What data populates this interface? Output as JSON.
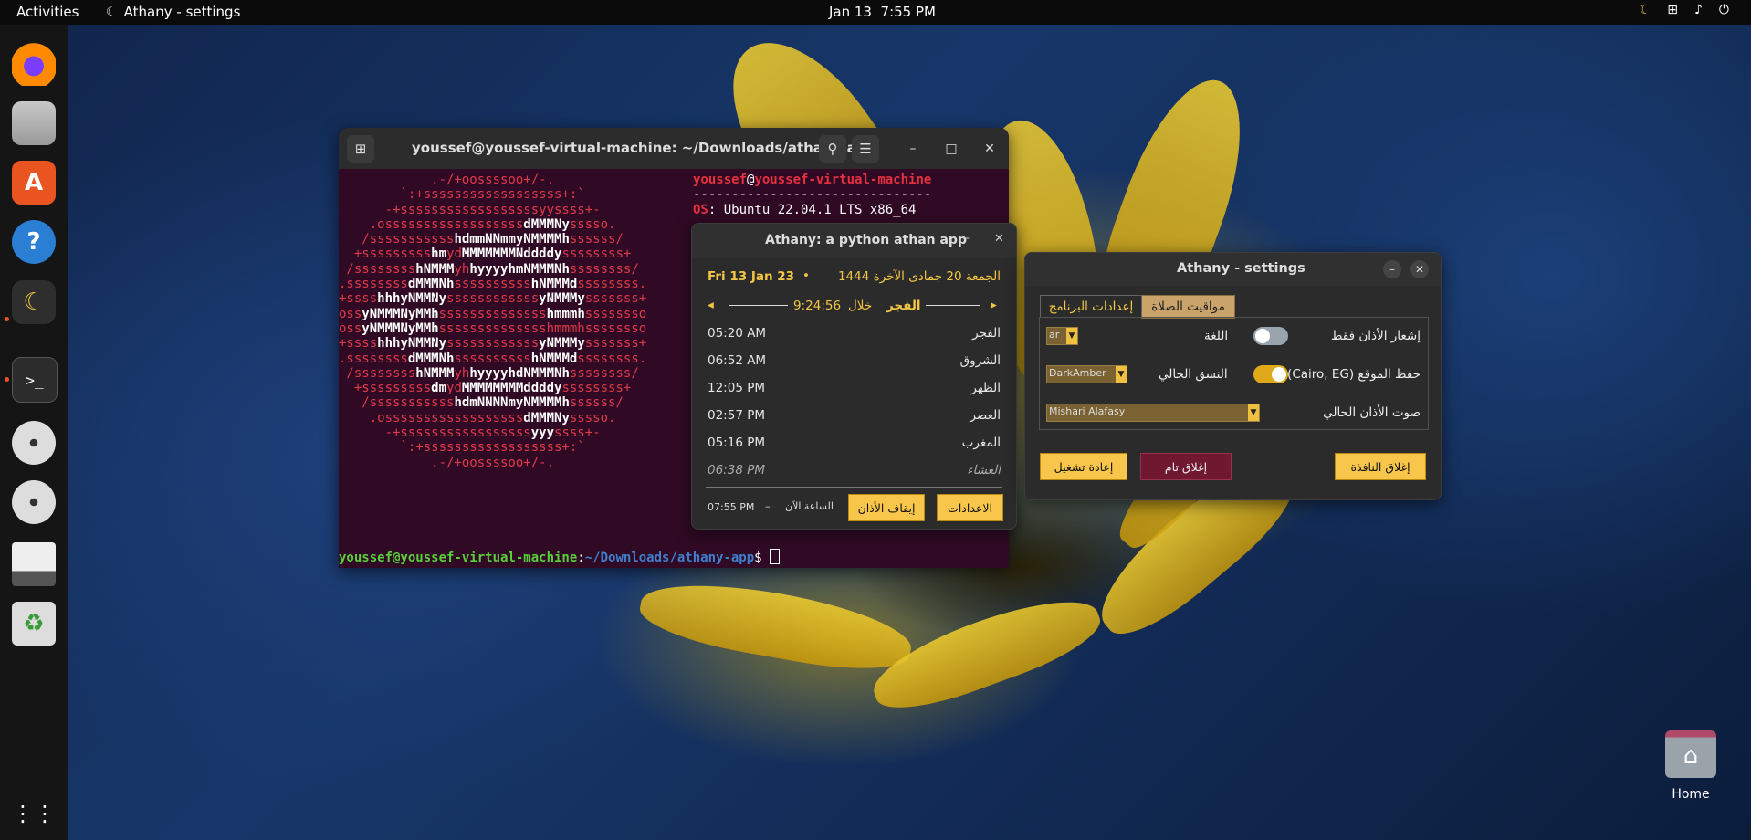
{
  "topbar": {
    "activities": "Activities",
    "app_name": "Athany - settings",
    "clock_date": "Jan 13",
    "clock_time": "7:55 PM"
  },
  "dock": {
    "items": [
      "firefox-icon",
      "files-icon",
      "app-center-icon",
      "help-icon",
      "athany-icon",
      "terminal-icon",
      "disc-icon",
      "disc-icon",
      "text-editor-icon",
      "trash-icon",
      "show-apps-icon"
    ]
  },
  "terminal": {
    "title": "youssef@youssef-virtual-machine: ~/Downloads/athany-app",
    "info_user": "youssef",
    "info_at": "@",
    "info_host": "youssef-virtual-machine",
    "info_sep": "-------------------------------",
    "info_os_key": "OS",
    "info_os_val": ": Ubuntu 22.04.1 LTS x86_64",
    "prompt_user": "youssef@youssef-virtual-machine",
    "prompt_colon": ":",
    "prompt_path": "~/Downloads/athany-app",
    "prompt_dollar": "$ "
  },
  "athany": {
    "title": "Athany: a python athan app",
    "gregorian_date": "Fri 13 Jan 23",
    "bullet": "•",
    "hijri_date": "الجمعة 20 جمادى الآخرة 1444",
    "countdown": "9:24:56",
    "within": "خلال",
    "next_prayer": "الفجر",
    "prayers": [
      {
        "name": "الفجر",
        "time": "05:20 AM"
      },
      {
        "name": "الشروق",
        "time": "06:52 AM"
      },
      {
        "name": "الظهر",
        "time": "12:05 PM"
      },
      {
        "name": "العصر",
        "time": "02:57 PM"
      },
      {
        "name": "المغرب",
        "time": "05:16 PM"
      },
      {
        "name": "العشاء",
        "time": "06:38 PM"
      }
    ],
    "current_time": "07:55 PM",
    "dash": "–",
    "now_label": "الساعة الآن",
    "stop_athan": "إيقاف الأذان",
    "settings_btn": "الاعدادات"
  },
  "settings": {
    "title": "Athany - settings",
    "tab_prayer_times": "مواقيت الصلاة",
    "tab_app_settings": "إعدادات البرنامج",
    "notify_only_label": "إشعار الأذان فقط",
    "language_label": "اللغة",
    "language_value": "ar",
    "save_location_label": "حفظ الموقع (Cairo, EG)",
    "theme_label": "النسق الحالي",
    "theme_value": "DarkAmber",
    "athan_voice_label": "صوت الأذان الحالي",
    "athan_voice_value": "Mishari Alafasy",
    "restart_btn": "إعادة تشغيل",
    "full_close_btn": "إغلاق تام",
    "close_window_btn": "إغلاق النافذة",
    "notify_only_on": false,
    "save_location_on": true
  },
  "desktop": {
    "home_label": "Home"
  },
  "colors": {
    "accent_gold": "#f8c64a",
    "terminal_bg": "#300a24",
    "close_red": "#6f1830"
  }
}
